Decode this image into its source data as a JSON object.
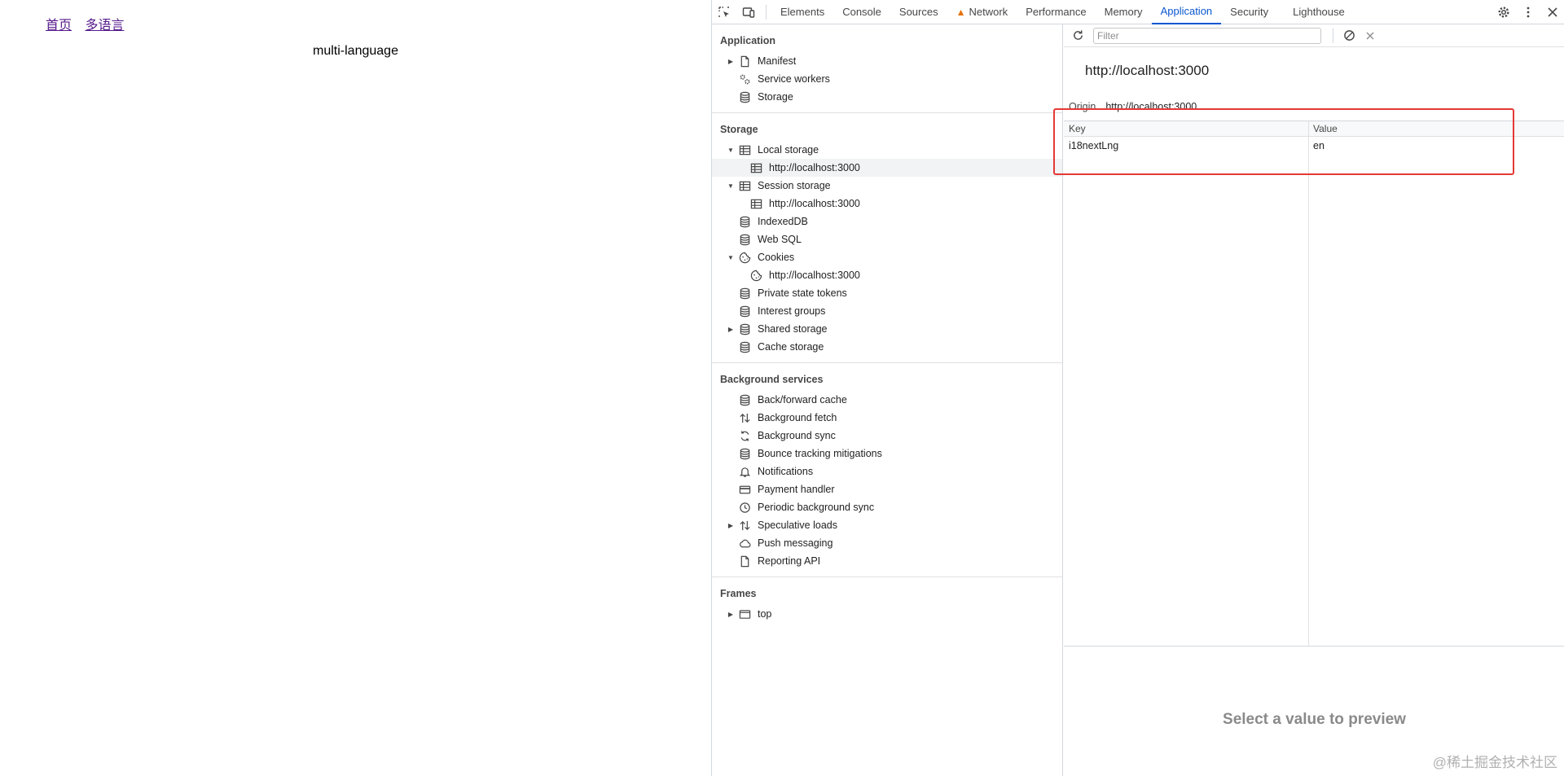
{
  "page": {
    "links": [
      "首页",
      "多语言"
    ],
    "heading": "multi-language"
  },
  "devtools": {
    "tabs": [
      "Elements",
      "Console",
      "Sources",
      "Network",
      "Performance",
      "Memory",
      "Application",
      "Security",
      "Lighthouse"
    ],
    "active_tab": "Application",
    "sidebar": {
      "sections": [
        {
          "title": "Application",
          "items": [
            {
              "label": "Manifest",
              "icon": "document-icon",
              "arrow": "collapsed",
              "level": 1
            },
            {
              "label": "Service workers",
              "icon": "gears-icon",
              "arrow": "none",
              "level": 1
            },
            {
              "label": "Storage",
              "icon": "database-icon",
              "arrow": "none",
              "level": 1
            }
          ]
        },
        {
          "title": "Storage",
          "items": [
            {
              "label": "Local storage",
              "icon": "table-icon",
              "arrow": "expanded",
              "level": 1
            },
            {
              "label": "http://localhost:3000",
              "icon": "table-icon",
              "arrow": "none",
              "level": 2,
              "selected": true
            },
            {
              "label": "Session storage",
              "icon": "table-icon",
              "arrow": "expanded",
              "level": 1
            },
            {
              "label": "http://localhost:3000",
              "icon": "table-icon",
              "arrow": "none",
              "level": 2
            },
            {
              "label": "IndexedDB",
              "icon": "database-icon",
              "arrow": "none",
              "level": 1
            },
            {
              "label": "Web SQL",
              "icon": "database-icon",
              "arrow": "none",
              "level": 1
            },
            {
              "label": "Cookies",
              "icon": "cookie-icon",
              "arrow": "expanded",
              "level": 1
            },
            {
              "label": "http://localhost:3000",
              "icon": "cookie-icon",
              "arrow": "none",
              "level": 2
            },
            {
              "label": "Private state tokens",
              "icon": "database-icon",
              "arrow": "none",
              "level": 1
            },
            {
              "label": "Interest groups",
              "icon": "database-icon",
              "arrow": "none",
              "level": 1
            },
            {
              "label": "Shared storage",
              "icon": "database-icon",
              "arrow": "collapsed",
              "level": 1
            },
            {
              "label": "Cache storage",
              "icon": "database-icon",
              "arrow": "none",
              "level": 1
            }
          ]
        },
        {
          "title": "Background services",
          "items": [
            {
              "label": "Back/forward cache",
              "icon": "database-icon",
              "arrow": "none",
              "level": 1
            },
            {
              "label": "Background fetch",
              "icon": "updown-arrows-icon",
              "arrow": "none",
              "level": 1
            },
            {
              "label": "Background sync",
              "icon": "sync-icon",
              "arrow": "none",
              "level": 1
            },
            {
              "label": "Bounce tracking mitigations",
              "icon": "database-icon",
              "arrow": "none",
              "level": 1
            },
            {
              "label": "Notifications",
              "icon": "bell-icon",
              "arrow": "none",
              "level": 1
            },
            {
              "label": "Payment handler",
              "icon": "card-icon",
              "arrow": "none",
              "level": 1
            },
            {
              "label": "Periodic background sync",
              "icon": "clock-icon",
              "arrow": "none",
              "level": 1
            },
            {
              "label": "Speculative loads",
              "icon": "updown-arrows-icon",
              "arrow": "collapsed",
              "level": 1
            },
            {
              "label": "Push messaging",
              "icon": "cloud-icon",
              "arrow": "none",
              "level": 1
            },
            {
              "label": "Reporting API",
              "icon": "document-icon",
              "arrow": "none",
              "level": 1
            }
          ]
        },
        {
          "title": "Frames",
          "items": [
            {
              "label": "top",
              "icon": "frame-icon",
              "arrow": "collapsed",
              "level": 1
            }
          ]
        }
      ]
    },
    "main": {
      "filter_placeholder": "Filter",
      "origin_title": "http://localhost:3000",
      "origin_label": "Origin",
      "origin_value": "http://localhost:3000",
      "table": {
        "columns": [
          "Key",
          "Value"
        ],
        "rows": [
          {
            "key": "i18nextLng",
            "value": "en"
          }
        ]
      },
      "preview_text": "Select a value to preview"
    }
  },
  "watermark": "@稀土掘金技术社区",
  "colors": {
    "accent": "#0b57d0",
    "highlight_box": "#e53935",
    "selected_row": "#f1f3f4",
    "warning": "#e8710a"
  }
}
